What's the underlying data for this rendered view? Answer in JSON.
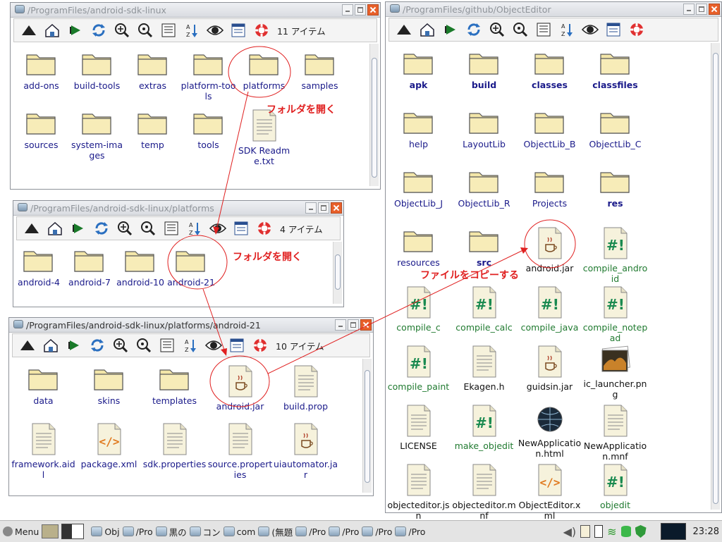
{
  "win1": {
    "title": "/ProgramFiles/android-sdk-linux",
    "count": "11 アイテム",
    "items": [
      {
        "label": "add-ons",
        "kind": "folder"
      },
      {
        "label": "build-tools",
        "kind": "folder"
      },
      {
        "label": "extras",
        "kind": "folder"
      },
      {
        "label": "platform-tools",
        "kind": "folder"
      },
      {
        "label": "platforms",
        "kind": "folder"
      },
      {
        "label": "samples",
        "kind": "folder"
      },
      {
        "label": "sources",
        "kind": "folder"
      },
      {
        "label": "system-images",
        "kind": "folder"
      },
      {
        "label": "temp",
        "kind": "folder"
      },
      {
        "label": "tools",
        "kind": "folder"
      },
      {
        "label": "SDK Readme.txt",
        "kind": "text"
      }
    ]
  },
  "win2": {
    "title": "/ProgramFiles/android-sdk-linux/platforms",
    "count": "4 アイテム",
    "items": [
      {
        "label": "android-4"
      },
      {
        "label": "android-7"
      },
      {
        "label": "android-10"
      },
      {
        "label": "android-21"
      }
    ]
  },
  "win3": {
    "title": "/ProgramFiles/android-sdk-linux/platforms/android-21",
    "count": "10 アイテム",
    "items": [
      {
        "label": "data",
        "kind": "folder"
      },
      {
        "label": "skins",
        "kind": "folder"
      },
      {
        "label": "templates",
        "kind": "folder"
      },
      {
        "label": "android.jar",
        "kind": "jar"
      },
      {
        "label": "build.prop",
        "kind": "text"
      },
      {
        "label": "framework.aidl",
        "kind": "text"
      },
      {
        "label": "package.xml",
        "kind": "xml"
      },
      {
        "label": "sdk.properties",
        "kind": "text"
      },
      {
        "label": "source.properties",
        "kind": "text"
      },
      {
        "label": "uiautomator.jar",
        "kind": "jar"
      }
    ]
  },
  "win4": {
    "title": "/ProgramFiles/github/ObjectEditor",
    "items": [
      {
        "label": "apk",
        "kind": "folder",
        "style": "bold"
      },
      {
        "label": "build",
        "kind": "folder",
        "style": "bold"
      },
      {
        "label": "classes",
        "kind": "folder",
        "style": "bold"
      },
      {
        "label": "classfiles",
        "kind": "folder",
        "style": "bold"
      },
      {
        "label": "help",
        "kind": "folder"
      },
      {
        "label": "LayoutLib",
        "kind": "folder"
      },
      {
        "label": "ObjectLib_B",
        "kind": "folder"
      },
      {
        "label": "ObjectLib_C",
        "kind": "folder"
      },
      {
        "label": "ObjectLib_J",
        "kind": "folder"
      },
      {
        "label": "ObjectLib_R",
        "kind": "folder"
      },
      {
        "label": "Projects",
        "kind": "folder"
      },
      {
        "label": "res",
        "kind": "folder",
        "style": "bold"
      },
      {
        "label": "resources",
        "kind": "folder"
      },
      {
        "label": "src",
        "kind": "folder",
        "style": "bold"
      },
      {
        "label": "android.jar",
        "kind": "jar",
        "style": "black"
      },
      {
        "label": "compile_android",
        "kind": "script",
        "style": "green"
      },
      {
        "label": "compile_c",
        "kind": "script",
        "style": "green"
      },
      {
        "label": "compile_calc",
        "kind": "script",
        "style": "green"
      },
      {
        "label": "compile_java",
        "kind": "script",
        "style": "green"
      },
      {
        "label": "compile_notepad",
        "kind": "script",
        "style": "green"
      },
      {
        "label": "compile_paint",
        "kind": "script",
        "style": "green"
      },
      {
        "label": "Ekagen.h",
        "kind": "text",
        "style": "black"
      },
      {
        "label": "guidsin.jar",
        "kind": "jar",
        "style": "black"
      },
      {
        "label": "ic_launcher.png",
        "kind": "image",
        "style": "black"
      },
      {
        "label": "LICENSE",
        "kind": "text",
        "style": "black"
      },
      {
        "label": "make_objedit",
        "kind": "script",
        "style": "green"
      },
      {
        "label": "NewApplication.html",
        "kind": "globe",
        "style": "black"
      },
      {
        "label": "NewApplication.mnf",
        "kind": "text",
        "style": "black"
      },
      {
        "label": "objecteditor.jsn",
        "kind": "text",
        "style": "black"
      },
      {
        "label": "objecteditor.mnf",
        "kind": "text",
        "style": "black"
      },
      {
        "label": "ObjectEditor.xml",
        "kind": "xml",
        "style": "black"
      },
      {
        "label": "objedit",
        "kind": "script",
        "style": "green"
      }
    ]
  },
  "annotations": {
    "open_folder_1": "フォルダを開く",
    "open_folder_2": "フォルダを開く",
    "copy_file": "ファイルをコピーする"
  },
  "taskbar": {
    "menu_label": "Menu",
    "tasks": [
      "Obj",
      "/Pro",
      "黒の",
      "コン",
      "com",
      "(無題",
      "/Pro",
      "/Pro",
      "/Pro",
      "/Pro"
    ],
    "clock": "23:28"
  },
  "colors": {
    "annotation": "#e02020",
    "folder": "#f3e6a8",
    "script": "#1a8a50",
    "label": "#1a1a8a",
    "close": "#e8602a"
  }
}
